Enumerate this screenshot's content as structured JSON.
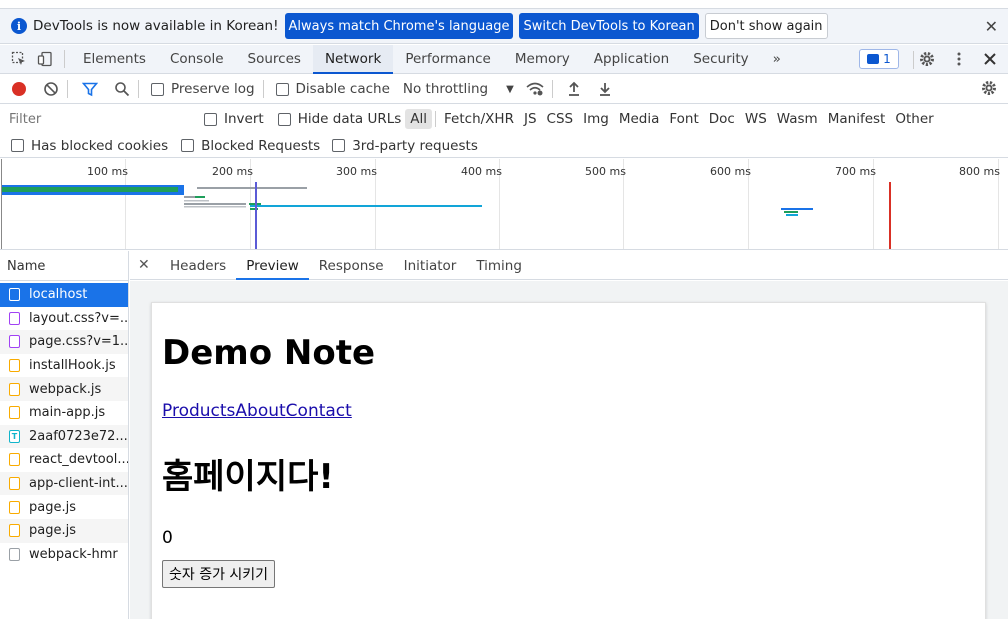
{
  "infobar": {
    "message": "DevTools is now available in Korean!",
    "btn_match": "Always match Chrome's language",
    "btn_switch": "Switch DevTools to Korean",
    "btn_dismiss": "Don't show again",
    "close": "✕"
  },
  "main_tabs": {
    "elements": "Elements",
    "console": "Console",
    "sources": "Sources",
    "network": "Network",
    "performance": "Performance",
    "memory": "Memory",
    "application": "Application",
    "security": "Security",
    "more": "»",
    "issues_count": "1"
  },
  "toolbar": {
    "preserve_log": "Preserve log",
    "disable_cache": "Disable cache",
    "throttling": "No throttling"
  },
  "filter": {
    "placeholder": "Filter",
    "invert": "Invert",
    "hide_data_urls": "Hide data URLs",
    "types": [
      "All",
      "Fetch/XHR",
      "JS",
      "CSS",
      "Img",
      "Media",
      "Font",
      "Doc",
      "WS",
      "Wasm",
      "Manifest",
      "Other"
    ],
    "has_blocked_cookies": "Has blocked cookies",
    "blocked_requests": "Blocked Requests",
    "third_party": "3rd-party requests"
  },
  "overview": {
    "ticks": [
      "100 ms",
      "200 ms",
      "300 ms",
      "400 ms",
      "500 ms",
      "600 ms",
      "700 ms",
      "800 ms"
    ]
  },
  "requests": {
    "header": "Name",
    "items": [
      {
        "name": "localhost",
        "type": "doc"
      },
      {
        "name": "layout.css?v=...",
        "type": "css"
      },
      {
        "name": "page.css?v=1...",
        "type": "css"
      },
      {
        "name": "installHook.js",
        "type": "js"
      },
      {
        "name": "webpack.js",
        "type": "js"
      },
      {
        "name": "main-app.js",
        "type": "js"
      },
      {
        "name": "2aaf0723e72...",
        "type": "txt"
      },
      {
        "name": "react_devtool...",
        "type": "js"
      },
      {
        "name": "app-client-int...",
        "type": "js"
      },
      {
        "name": "page.js",
        "type": "js"
      },
      {
        "name": "page.js",
        "type": "js"
      },
      {
        "name": "webpack-hmr",
        "type": "other"
      }
    ]
  },
  "detail_tabs": {
    "close": "✕",
    "headers": "Headers",
    "preview": "Preview",
    "response": "Response",
    "initiator": "Initiator",
    "timing": "Timing"
  },
  "preview": {
    "title": "Demo Note",
    "links": [
      "Products",
      "About",
      "Contact"
    ],
    "heading": "홈페이지다!",
    "count": "0",
    "button": "숫자 증가 시키기"
  },
  "colors": {
    "accent": "#0b57d0",
    "record": "#d93025",
    "selected_row": "#1a73e8"
  }
}
